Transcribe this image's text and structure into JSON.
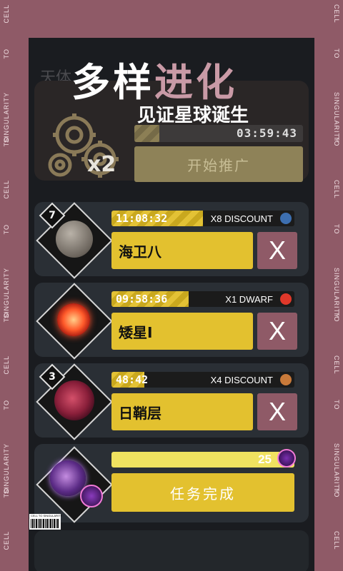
{
  "frame": {
    "side_words": [
      "CELL",
      "TO",
      "SINGULARITY",
      "TO",
      "CELL",
      "TO",
      "SINGULARITY",
      "TO",
      "CELL",
      "TO",
      "SINGULARITY",
      "TO",
      "CELL"
    ]
  },
  "header": {
    "bg_text": "天体",
    "title_white": "多样",
    "title_pink": "进化",
    "subtitle": "见证星球诞生"
  },
  "top_card": {
    "multiplier": "x2",
    "timer": "03:59:43",
    "timer_progress": 0.15,
    "button_label": "开始推广"
  },
  "cards": [
    {
      "badge": "7",
      "timer": "11:08:32",
      "progress": 0.5,
      "tag": "X8 DISCOUNT",
      "name": "海卫八",
      "close": "X",
      "dot_color": "#3d6fb0"
    },
    {
      "badge": "",
      "timer": "09:58:36",
      "progress": 0.42,
      "tag": "X1 DWARF",
      "name": "矮星I",
      "close": "X",
      "dot_color": "#e0382a"
    },
    {
      "badge": "3",
      "timer": "48:42",
      "progress": 0.18,
      "tag": "X4 DISCOUNT",
      "name": "日鞘层",
      "close": "X",
      "dot_color": "#c97a3a"
    }
  ],
  "task_card": {
    "count": "25",
    "button_label": "任务完成"
  },
  "barcode": {
    "text": "CELL TO SINGULARITY"
  }
}
